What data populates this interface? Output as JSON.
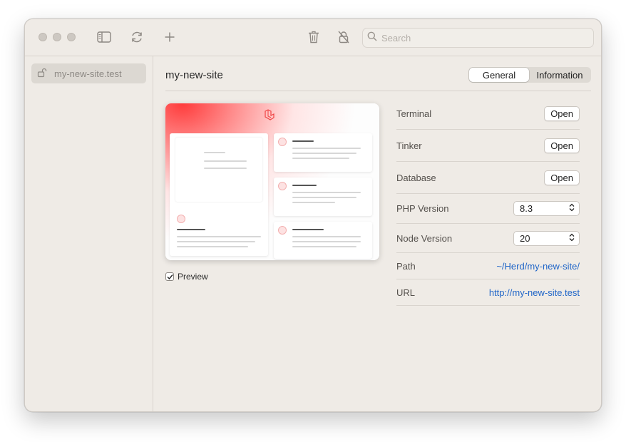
{
  "toolbar": {
    "search_placeholder": "Search"
  },
  "sidebar": {
    "items": [
      {
        "label": "my-new-site.test",
        "icon": "lock-open-icon"
      }
    ]
  },
  "main": {
    "title": "my-new-site",
    "tabs": [
      {
        "label": "General",
        "active": true
      },
      {
        "label": "Information",
        "active": false
      }
    ],
    "preview_label": "Preview",
    "preview_checked": true,
    "rows": [
      {
        "key": "Terminal",
        "type": "button",
        "value": "Open"
      },
      {
        "key": "Tinker",
        "type": "button",
        "value": "Open"
      },
      {
        "key": "Database",
        "type": "button",
        "value": "Open"
      },
      {
        "key": "PHP Version",
        "type": "select",
        "value": "8.3"
      },
      {
        "key": "Node Version",
        "type": "select",
        "value": "20"
      },
      {
        "key": "Path",
        "type": "link",
        "value": "~/Herd/my-new-site/"
      },
      {
        "key": "URL",
        "type": "link",
        "value": "http://my-new-site.test"
      }
    ]
  },
  "colors": {
    "window_bg": "#efebe6",
    "link": "#1f65c8",
    "accent_red": "#ff2d20"
  }
}
